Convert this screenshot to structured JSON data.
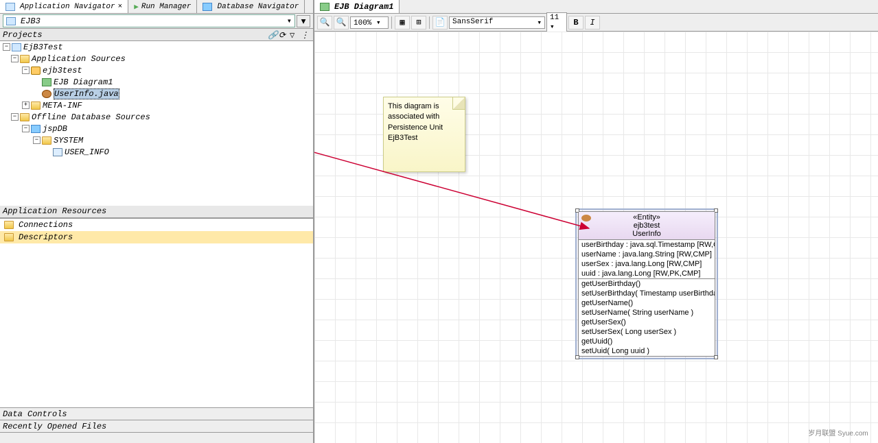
{
  "nav_tabs": [
    {
      "label": "Application Navigator",
      "active": true
    },
    {
      "label": "Run Manager",
      "active": false
    },
    {
      "label": "Database Navigator",
      "active": false
    }
  ],
  "project_selector": "EJB3",
  "sections": {
    "projects": "Projects",
    "app_resources": "Application Resources",
    "data_controls": "Data Controls",
    "recent_files": "Recently Opened Files"
  },
  "tree": {
    "root": "EjB3Test",
    "app_sources": "Application Sources",
    "pkg": "ejb3test",
    "diagram": "EJB Diagram1",
    "userinfo": "UserInfo.java",
    "metainf": "META-INF",
    "offline_db": "Offline Database Sources",
    "jspdb": "jspDB",
    "system": "SYSTEM",
    "user_info_tbl": "USER_INFO"
  },
  "resources": {
    "connections": "Connections",
    "descriptors": "Descriptors"
  },
  "editor": {
    "tab": "EJB Diagram1",
    "zoom": "100%",
    "font": "SansSerif",
    "size": "11"
  },
  "note": {
    "text": "This diagram is associated with Persistence Unit EjB3Test"
  },
  "entity": {
    "stereotype": "«Entity»",
    "pkg": "ejb3test",
    "name": "UserInfo",
    "attrs": [
      "userBirthday : java.sql.Timestamp [RW,CMP]",
      "userName : java.lang.String [RW,CMP]",
      "userSex : java.lang.Long [RW,CMP]",
      "uuid : java.lang.Long [RW,PK,CMP]"
    ],
    "methods": [
      "getUserBirthday()",
      "setUserBirthday( Timestamp userBirthday )",
      "getUserName()",
      "setUserName( String userName )",
      "getUserSex()",
      "setUserSex( Long userSex )",
      "getUuid()",
      "setUuid( Long uuid )"
    ]
  },
  "watermark": "岁月联盟 Syue.com"
}
